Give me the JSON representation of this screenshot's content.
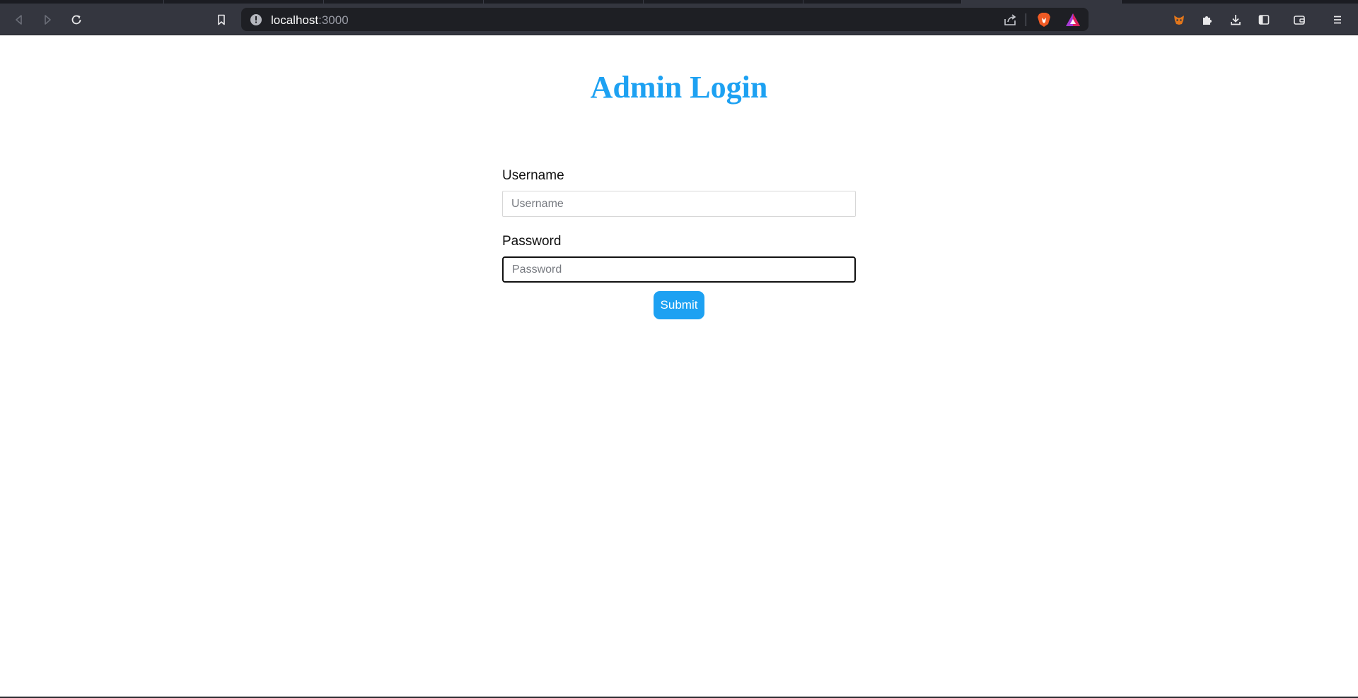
{
  "browser": {
    "url_host": "localhost",
    "url_port": ":3000",
    "icons": [
      "back-icon",
      "forward-icon",
      "reload-icon",
      "bookmark-icon",
      "site-info-icon",
      "share-icon",
      "brave-shields-icon",
      "brave-rewards-icon",
      "metamask-icon",
      "extensions-icon",
      "download-icon",
      "sidebar-icon",
      "wallet-icon",
      "menu-icon"
    ]
  },
  "page": {
    "title": "Admin Login",
    "username": {
      "label": "Username",
      "placeholder": "Username",
      "value": ""
    },
    "password": {
      "label": "Password",
      "placeholder": "Password",
      "value": ""
    },
    "submit_label": "Submit"
  },
  "colors": {
    "accent": "#1da1f2",
    "chrome_bg": "#34363f",
    "urlbar_bg": "#1e1f24"
  }
}
